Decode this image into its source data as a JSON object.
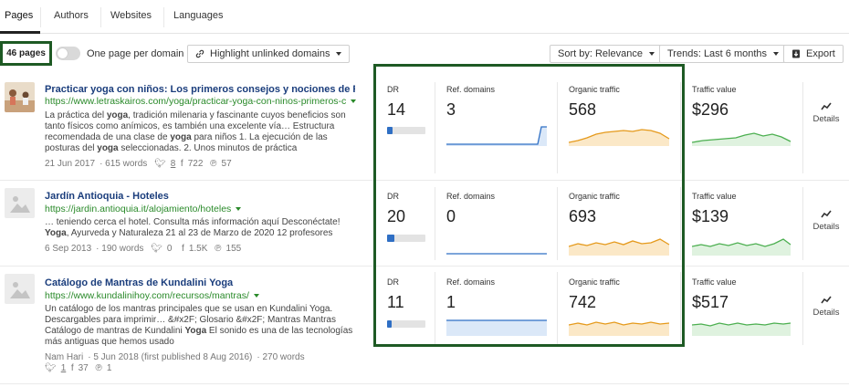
{
  "tabs": [
    {
      "label": "Pages"
    },
    {
      "label": "Authors"
    },
    {
      "label": "Websites"
    },
    {
      "label": "Languages"
    }
  ],
  "toolbar": {
    "pages_count": "46 pages",
    "one_page_label": "One page per domain",
    "highlight_label": "Highlight unlinked domains",
    "sort_label": "Sort by: Relevance",
    "trends_label": "Trends: Last 6 months",
    "export_label": "Export"
  },
  "metric_labels": {
    "dr": "DR",
    "ref_domains": "Ref. domains",
    "organic_traffic": "Organic traffic",
    "traffic_value": "Traffic value",
    "details": "Details"
  },
  "colors": {
    "link_blue": "#1a3d7c",
    "url_green": "#2a8a2a",
    "spark_blue": "#2f6fc4",
    "spark_orange": "#e59a1c",
    "spark_green": "#4caf50",
    "highlight_border": "#1e5a24"
  },
  "results": [
    {
      "title": "Practicar yoga con niños: Los primeros consejos y nociones de Ram",
      "url": "https://www.letraskairos.com/yoga/practicar-yoga-con-ninos-primeros-c",
      "snippet": [
        "La práctica del ",
        "yoga",
        ", tradición milenaria y fascinante cuyos beneficios son tanto físicos como anímicos, es también una excelente vía… Estructura recomendada de una clase de ",
        "yoga",
        " para niños 1. La ejecución de las posturas del ",
        "yoga",
        " seleccionadas. 2. Unos minutos de práctica"
      ],
      "date": "21 Jun 2017",
      "words": "615 words",
      "twitter": "8",
      "facebook": "722",
      "pinterest": "57",
      "dr": "14",
      "dr_fraction": 0.14,
      "ref_domains": "3",
      "organic_traffic": "568",
      "traffic_value": "$296",
      "has_thumb": true
    },
    {
      "title": "Jardín Antioquia - Hoteles",
      "url": "https://jardin.antioquia.it/alojamiento/hoteles",
      "snippet": [
        "… teniendo cerca el hotel. Consulta más información aquí Desconéctate! ",
        "Yoga",
        ", Ayurveda y Naturaleza 21 al 23 de Marzo de 2020 12 profesores"
      ],
      "date": "6 Sep 2013",
      "words": "190 words",
      "twitter": "0",
      "facebook": "1.5K",
      "pinterest": "155",
      "dr": "20",
      "dr_fraction": 0.2,
      "ref_domains": "0",
      "organic_traffic": "693",
      "traffic_value": "$139",
      "has_thumb": false
    },
    {
      "title": "Catálogo de Mantras de Kundalini Yoga",
      "url": "https://www.kundalinihoy.com/recursos/mantras/",
      "snippet": [
        "Un catálogo de los mantras principales que se usan en Kundalini Yoga. Descargables para imprimir… &#x2F; Glosario &#x2F; Mantras Mantras Catálogo de mantras de Kundalini ",
        "Yoga",
        " El sonido es una de las tecnologías más antiguas que hemos usado"
      ],
      "author": "Nam Hari",
      "date": "5 Jun 2018 (first published 8 Aug 2016)",
      "words": "270 words",
      "twitter": "1",
      "facebook": "37",
      "pinterest": "1",
      "dr": "11",
      "dr_fraction": 0.11,
      "ref_domains": "1",
      "organic_traffic": "742",
      "traffic_value": "$517",
      "has_thumb": false
    }
  ]
}
